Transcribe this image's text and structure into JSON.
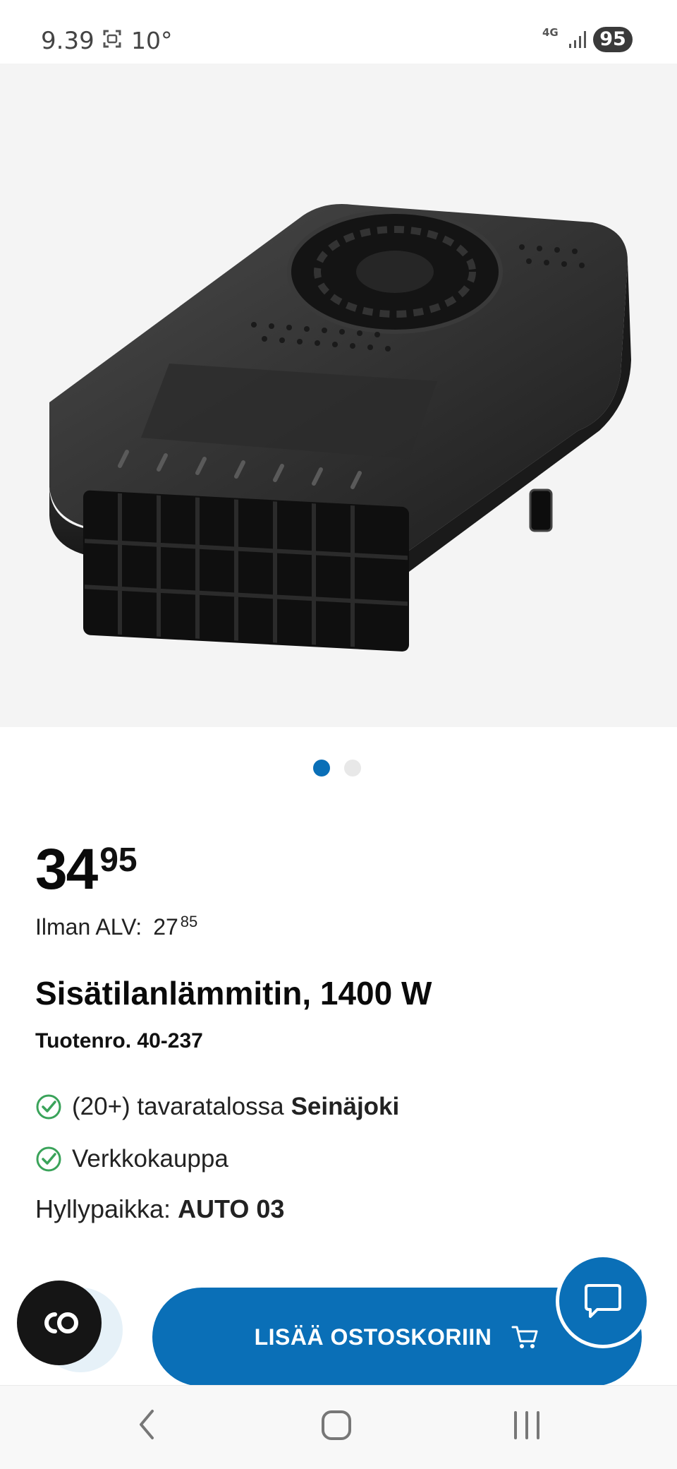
{
  "status_bar": {
    "time": "9.39",
    "temperature": "10°",
    "network": "4G",
    "battery": "95"
  },
  "gallery": {
    "image_label": "",
    "active_index": 0,
    "count": 2
  },
  "product": {
    "price_main": "34",
    "price_cents": "95",
    "vat_label": "Ilman ALV:",
    "vat_main": "27",
    "vat_cents": "85",
    "title": "Sisätilanlämmitin, 1400 W",
    "sku": "Tuotenro. 40-237"
  },
  "availability": [
    {
      "text": "(20+) tavaratalossa",
      "bold": "Seinäjoki"
    },
    {
      "text": "Verkkokauppa",
      "bold": ""
    }
  ],
  "shelf": {
    "label": "Hyllypaikka:",
    "value": "AUTO 03"
  },
  "actions": {
    "add_to_cart": "LISÄÄ OSTOSKORIIN"
  },
  "colors": {
    "brand_blue": "#0a6fb7",
    "check_green": "#3aa35a"
  }
}
